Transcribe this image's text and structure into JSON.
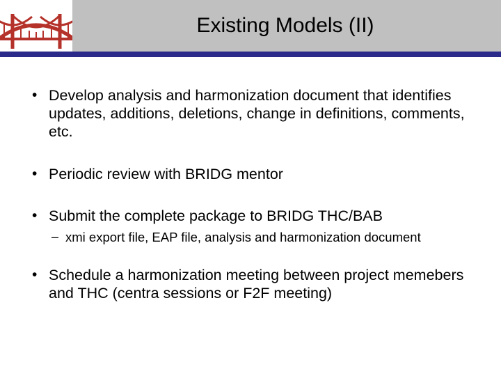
{
  "header": {
    "title": "Existing Models (II)"
  },
  "bullets": {
    "b1": "Develop analysis and harmonization document that identifies updates, additions, deletions, change in definitions, comments, etc.",
    "b2": "Periodic review with BRIDG mentor",
    "b3": "Submit the complete package to BRIDG THC/BAB",
    "b3_sub1": "xmi export file, EAP file, analysis and harmonization document",
    "b4": "Schedule a harmonization meeting between project memebers and THC (centra sessions or F2F meeting)"
  }
}
